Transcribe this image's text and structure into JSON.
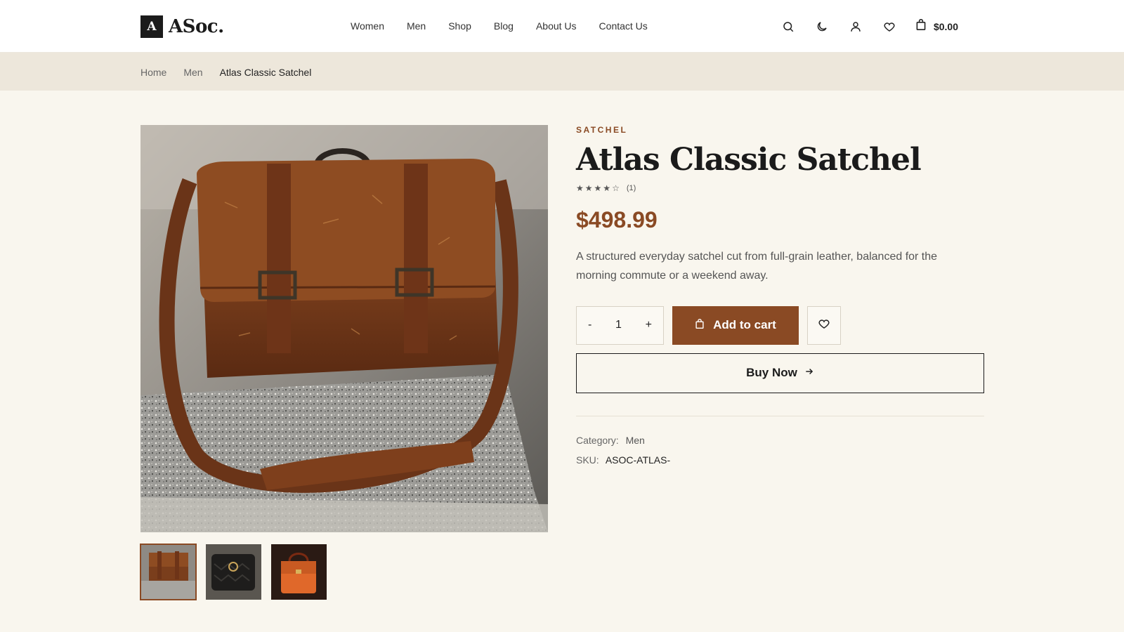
{
  "brand": {
    "mark": "A",
    "name": "ASoc."
  },
  "nav": {
    "items": [
      "Women",
      "Men",
      "Shop",
      "Blog",
      "About Us",
      "Contact Us"
    ]
  },
  "header": {
    "cart_total": "$0.00"
  },
  "breadcrumb": {
    "items": [
      "Home",
      "Men",
      "Atlas Classic Satchel"
    ]
  },
  "product": {
    "eyebrow": "SATCHEL",
    "title": "Atlas Classic Satchel",
    "rating_value": 4,
    "rating_max": 5,
    "rating_count": "(1)",
    "price": "$498.99",
    "description": "A structured everyday satchel cut from full-grain leather, balanced for the morning commute or a weekend away.",
    "quantity": "1",
    "qty_minus": "-",
    "qty_plus": "+",
    "add_to_cart": "Add to cart",
    "buy_now": "Buy Now",
    "category_label": "Category:",
    "category_value": "Men",
    "sku_label": "SKU:",
    "sku_value": "ASOC-ATLAS-"
  },
  "colors": {
    "accent": "#8a4a24",
    "background": "#f9f6ee",
    "breadcrumb_bg": "#ede7db"
  }
}
